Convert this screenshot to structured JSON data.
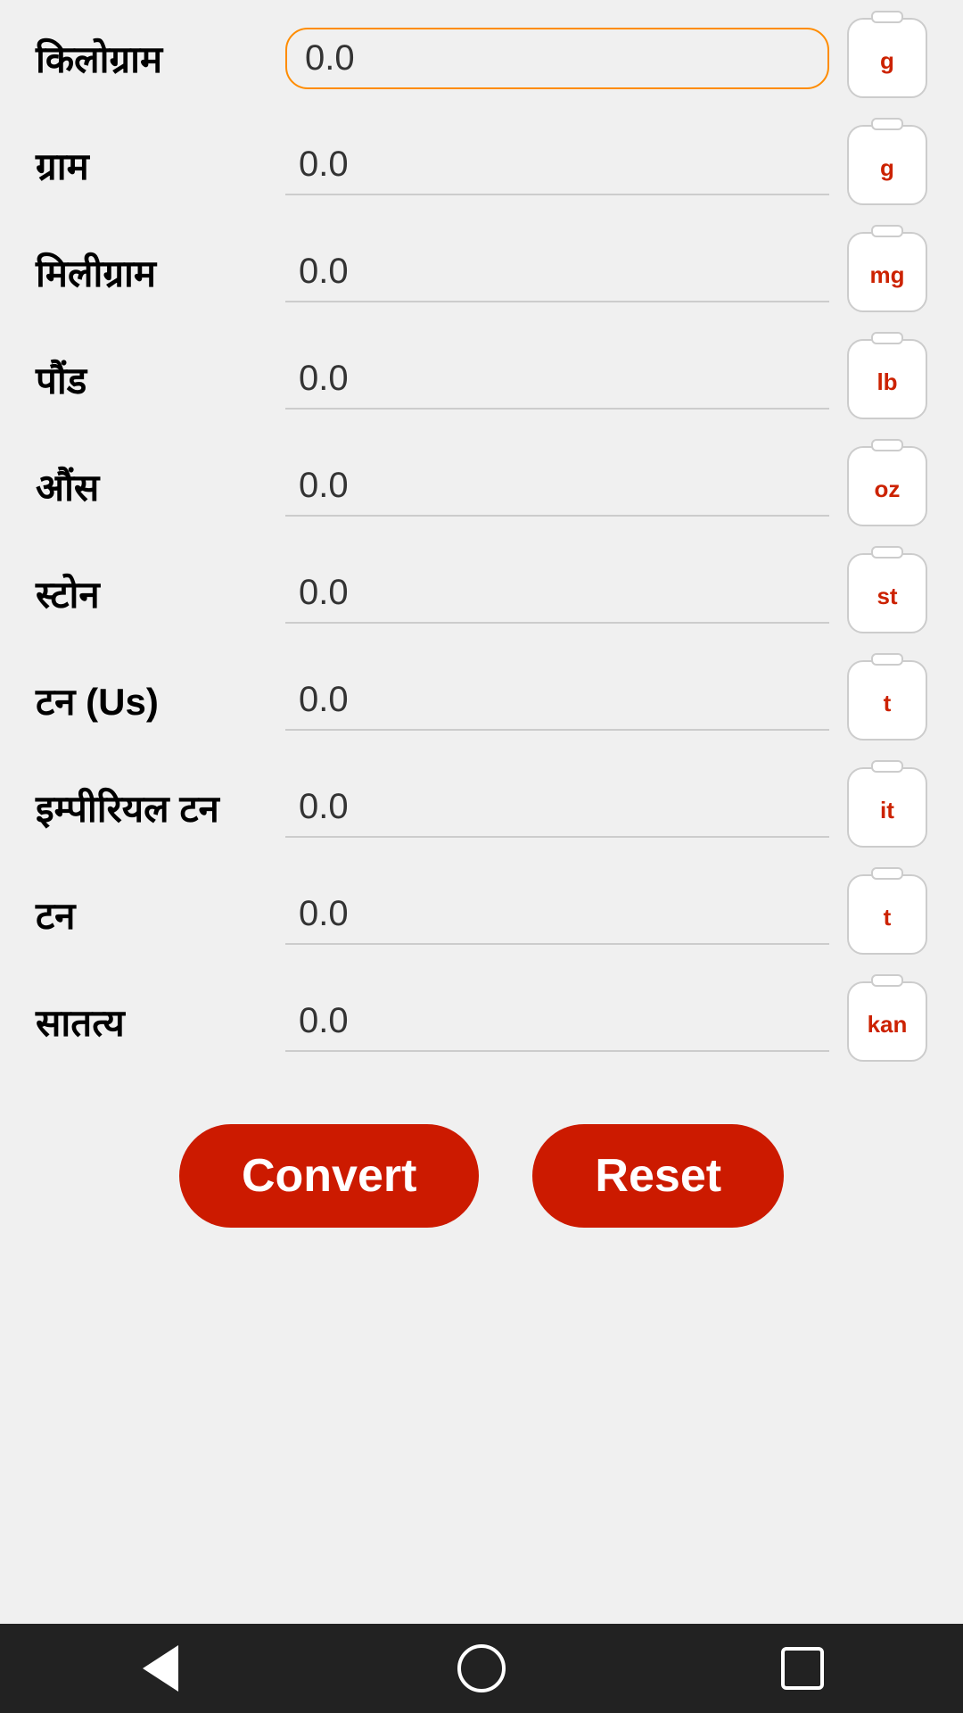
{
  "units": [
    {
      "id": "kilogram-partial",
      "label": "किलोग्राम",
      "value": "0.0",
      "icon": "g",
      "isActive": true
    },
    {
      "id": "gram",
      "label": "ग्राम",
      "value": "0.0",
      "icon": "g",
      "isActive": false
    },
    {
      "id": "milligram",
      "label": "मिलीग्राम",
      "value": "0.0",
      "icon": "mg",
      "isActive": false
    },
    {
      "id": "pound",
      "label": "पौंड",
      "value": "0.0",
      "icon": "lb",
      "isActive": false
    },
    {
      "id": "ounce",
      "label": "औंस",
      "value": "0.0",
      "icon": "oz",
      "isActive": false
    },
    {
      "id": "stone",
      "label": "स्टोन",
      "value": "0.0",
      "icon": "st",
      "isActive": false
    },
    {
      "id": "ton-us",
      "label": "टन (Us)",
      "value": "0.0",
      "icon": "t",
      "isActive": false
    },
    {
      "id": "imperial-ton",
      "label": "इम्पीरियल टन",
      "value": "0.0",
      "icon": "it",
      "isActive": false
    },
    {
      "id": "ton",
      "label": "टन",
      "value": "0.0",
      "icon": "t",
      "isActive": false
    },
    {
      "id": "satatya",
      "label": "सातत्य",
      "value": "0.0",
      "icon": "kan",
      "isActive": false
    }
  ],
  "buttons": {
    "convert": "Convert",
    "reset": "Reset"
  },
  "navbar": {
    "back": "back",
    "home": "home",
    "recent": "recent"
  }
}
